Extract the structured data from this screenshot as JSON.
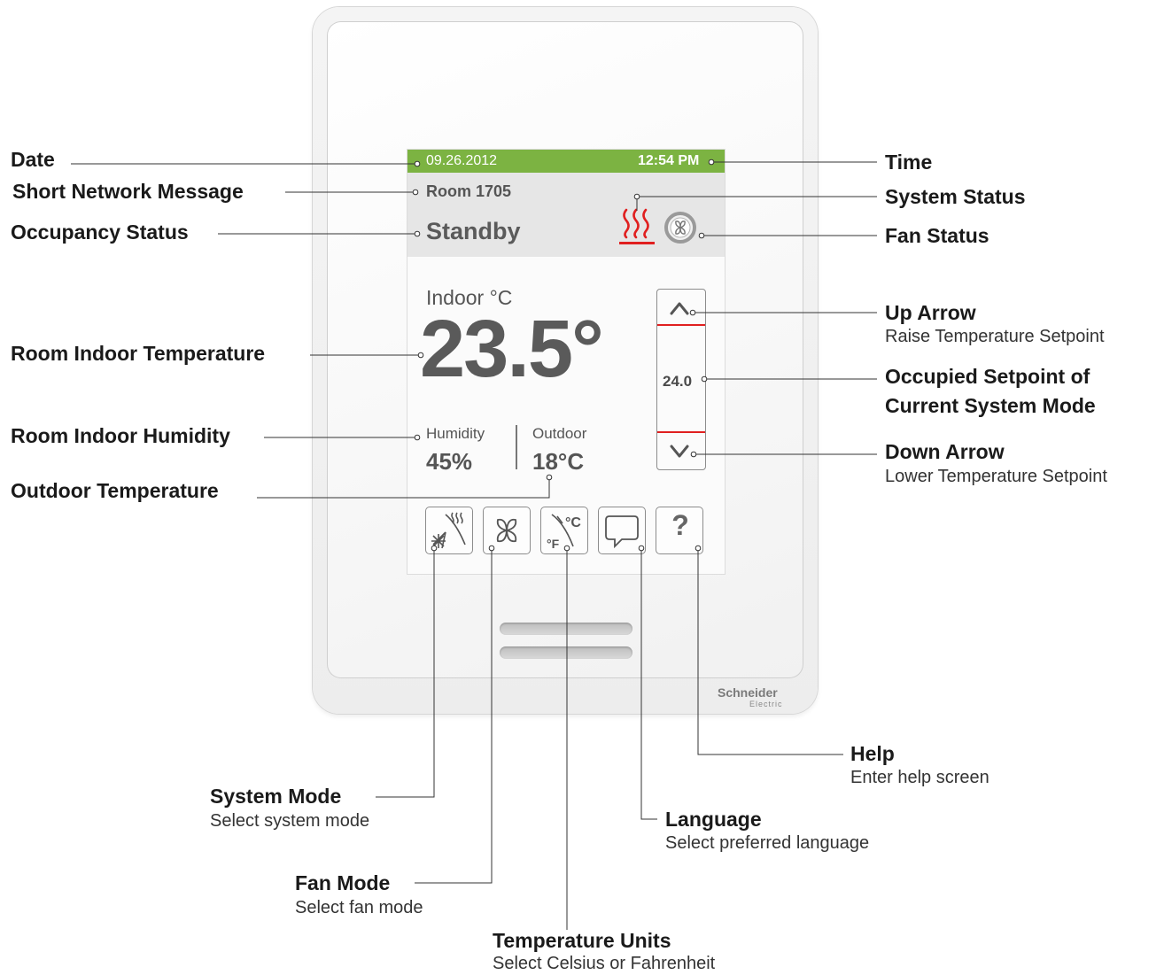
{
  "screen": {
    "date": "09.26.2012",
    "time": "12:54 PM",
    "network_message": "Room 1705",
    "occupancy": "Standby",
    "indoor_label": "Indoor °C",
    "indoor_temp": "23.5°",
    "humidity_label": "Humidity",
    "humidity_value": "45%",
    "outdoor_label": "Outdoor",
    "outdoor_value": "18°C",
    "setpoint": "24.0",
    "help_glyph": "?",
    "units_c": "°C",
    "units_f": "°F",
    "heating_color": "#e02020",
    "bar_color": "#7cb342"
  },
  "brand": {
    "name": "Schneider",
    "sub": "Electric"
  },
  "labels": {
    "date": "Date",
    "network_message": "Short Network Message",
    "occupancy": "Occupancy Status",
    "indoor_temp": "Room Indoor Temperature",
    "indoor_humidity": "Room Indoor Humidity",
    "outdoor_temp": "Outdoor Temperature",
    "time": "Time",
    "system_status": "System Status",
    "fan_status": "Fan Status",
    "up_arrow": "Up Arrow",
    "up_arrow_sub": "Raise Temperature Setpoint",
    "setpoint_line1": "Occupied Setpoint of",
    "setpoint_line2": "Current System Mode",
    "down_arrow": "Down Arrow",
    "down_arrow_sub": "Lower Temperature Setpoint",
    "help": "Help",
    "help_sub": "Enter help screen",
    "system_mode": "System Mode",
    "system_mode_sub": "Select system mode",
    "language": "Language",
    "language_sub": "Select preferred language",
    "fan_mode": "Fan Mode",
    "fan_mode_sub": "Select fan mode",
    "temp_units": "Temperature Units",
    "temp_units_sub": "Select Celsius or Fahrenheit"
  }
}
